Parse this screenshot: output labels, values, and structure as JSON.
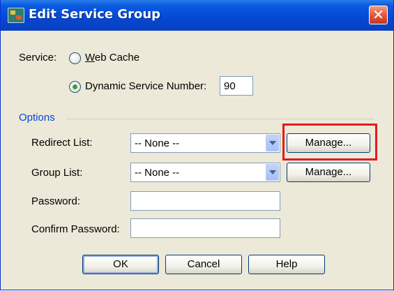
{
  "window": {
    "title": "Edit Service Group",
    "close_glyph": "✕"
  },
  "service": {
    "label": "Service:",
    "web_cache_label": "Web Cache",
    "dynamic_label": "Dynamic Service Number:",
    "dynamic_value": "90",
    "selected": "dynamic"
  },
  "options": {
    "group_label": "Options",
    "redirect_list": {
      "label": "Redirect List:",
      "value": "-- None --",
      "manage_label": "Manage..."
    },
    "group_list": {
      "label": "Group List:",
      "value": "-- None --",
      "manage_label": "Manage..."
    },
    "password": {
      "label": "Password:",
      "value": ""
    },
    "confirm_password": {
      "label": "Confirm Password:",
      "value": ""
    }
  },
  "buttons": {
    "ok": "OK",
    "cancel": "Cancel",
    "help": "Help"
  },
  "colors": {
    "highlight": "#e8171d",
    "titlebar": "#0449d6",
    "group_label": "#0046d5"
  },
  "icons": {
    "window": "app-window-icon",
    "close": "close-icon",
    "dropdown": "chevron-down-icon"
  }
}
